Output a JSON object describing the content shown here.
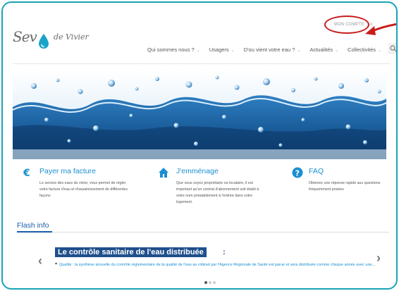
{
  "header": {
    "logo_script": "Sev",
    "logo_tail": "de Vivier",
    "account_label": "MON COMPTE"
  },
  "nav": {
    "items": [
      {
        "label": "Qui sommes nous ?"
      },
      {
        "label": "Usagers"
      },
      {
        "label": "D'ou vient votre eau ?"
      },
      {
        "label": "Actualités"
      },
      {
        "label": "Collectivités"
      }
    ],
    "search_icon": "search-icon"
  },
  "features": [
    {
      "icon": "euro-icon",
      "title": "Payer ma facture",
      "text": "Le service des eaux du vivier, vous permet de régler votre facture d'eau et d'assainissement de différentes façons"
    },
    {
      "icon": "home-icon",
      "title": "J'emménage",
      "text": "Que vous soyez propriétaire ou locataire, il est important qu'un contrat d'abonnement soit établi à votre nom préalablement à l'entrée dans votre logement."
    },
    {
      "icon": "question-icon",
      "title": "FAQ",
      "text": "Obtenez une réponse rapide aux questions fréquemment posées"
    }
  ],
  "flash": {
    "title": "Flash info",
    "headline": "Le contrôle sanitaire de l'eau distribuée",
    "headline_colon": ":",
    "quote_mark": "❝",
    "quote": "Qualité : la synthèse annuelle du contrôle réglementaire de la qualité de l'eau au robinet par l'Agence Régionale de Santé est parue et sera distribuée comme chaque année avec une..."
  },
  "colors": {
    "frame": "#1aa3b8",
    "accent_blue": "#1a8fd1",
    "headline_bg": "#1f4f8c",
    "annotation_red": "#c81d1d"
  }
}
